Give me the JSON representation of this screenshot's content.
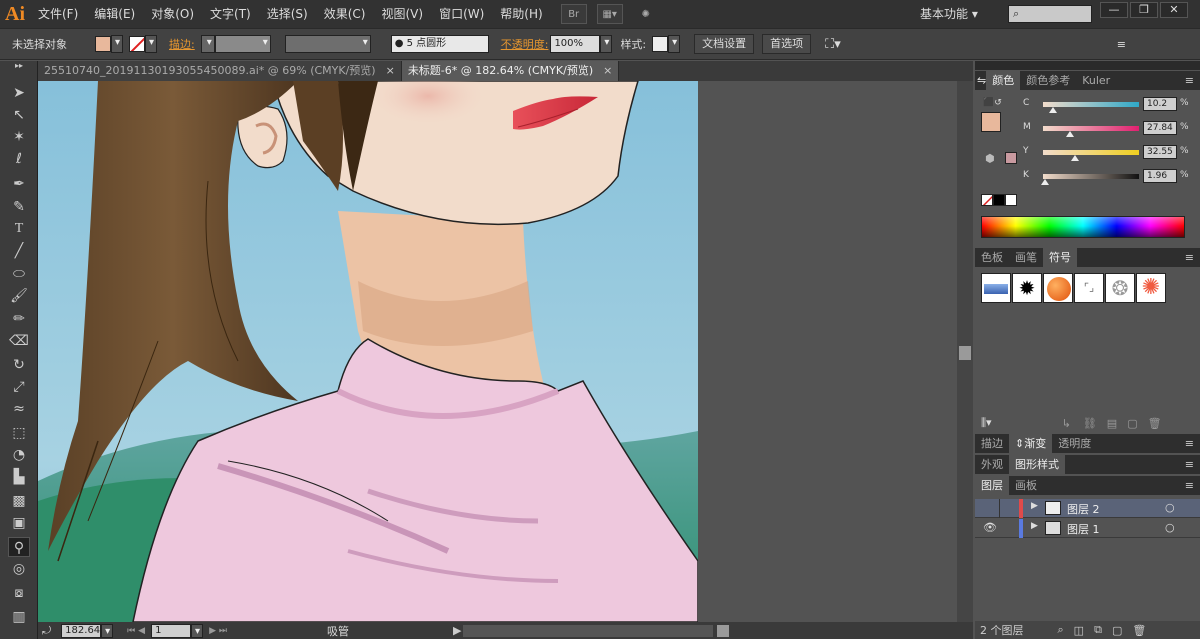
{
  "app": {
    "logo": "Ai"
  },
  "menu": [
    "文件(F)",
    "编辑(E)",
    "对象(O)",
    "文字(T)",
    "选择(S)",
    "效果(C)",
    "视图(V)",
    "窗口(W)",
    "帮助(H)"
  ],
  "menubar_extra": {
    "bridge_label": "Br"
  },
  "workspace": "基本功能",
  "window_buttons": [
    "—",
    "❐",
    "✕"
  ],
  "control": {
    "selection_status": "未选择对象",
    "stroke_label": "描边:",
    "brush_label": "5 点圆形",
    "opacity_label": "不透明度:",
    "opacity_value": "100%",
    "style_label": "样式:",
    "doc_settings": "文档设置",
    "preferences": "首选项",
    "fill_color": "#e8b89c"
  },
  "tabs": [
    {
      "label": "25510740_20191130193055450089.ai* @ 69% (CMYK/预览)",
      "close": "×"
    },
    {
      "label": "未标题-6* @ 182.64% (CMYK/预览)",
      "close": "×"
    }
  ],
  "statusbar": {
    "zoom": "182.64",
    "artboard": "1",
    "tool": "吸管"
  },
  "color_panel": {
    "tabs": [
      "颜色",
      "颜色参考",
      "Kuler"
    ],
    "channels": [
      {
        "label": "C",
        "value": "10.2",
        "pos": 0.1
      },
      {
        "label": "M",
        "value": "27.84",
        "pos": 0.28
      },
      {
        "label": "Y",
        "value": "32.55",
        "pos": 0.33
      },
      {
        "label": "K",
        "value": "1.96",
        "pos": 0.02
      }
    ]
  },
  "swatch_panel": {
    "tabs": [
      "色板",
      "画笔",
      "符号"
    ]
  },
  "stroke_panel": {
    "tabs": [
      "描边",
      "渐变",
      "透明度"
    ]
  },
  "appearance_panel": {
    "tabs": [
      "外观",
      "图形样式"
    ]
  },
  "layers_panel": {
    "tabs": [
      "图层",
      "画板"
    ],
    "layers": [
      {
        "name": "图层 2",
        "selected": true
      },
      {
        "name": "图层 1",
        "selected": false
      }
    ],
    "count": "2 个图层"
  }
}
